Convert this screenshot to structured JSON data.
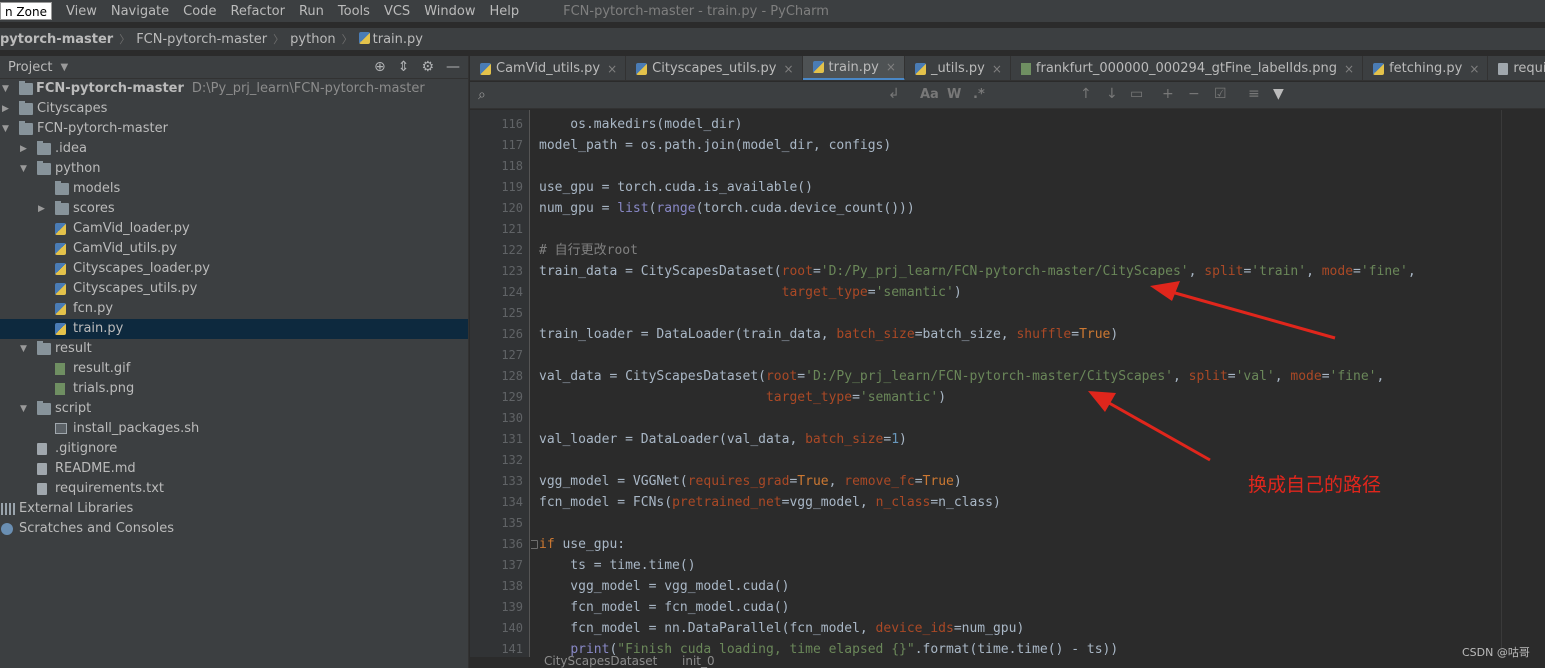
{
  "menubar": {
    "zone_label": "n Zone",
    "items": [
      "View",
      "Navigate",
      "Code",
      "Refactor",
      "Run",
      "Tools",
      "VCS",
      "Window",
      "Help"
    ],
    "window_title": "FCN-pytorch-master - train.py - PyCharm"
  },
  "breadcrumbs": [
    "pytorch-master",
    "FCN-pytorch-master",
    "python",
    "train.py"
  ],
  "project": {
    "header_label": "Project",
    "root_name": "FCN-pytorch-master",
    "root_path": "D:\\Py_prj_learn\\FCN-pytorch-master",
    "tree": [
      {
        "label": "Cityscapes",
        "kind": "folder",
        "depth": 0,
        "arrow": "right"
      },
      {
        "label": "FCN-pytorch-master",
        "kind": "folder",
        "depth": 0,
        "arrow": "down"
      },
      {
        "label": ".idea",
        "kind": "folder",
        "depth": 1,
        "arrow": "right"
      },
      {
        "label": "python",
        "kind": "folder",
        "depth": 1,
        "arrow": "down"
      },
      {
        "label": "models",
        "kind": "folder",
        "depth": 2,
        "arrow": ""
      },
      {
        "label": "scores",
        "kind": "folder",
        "depth": 2,
        "arrow": "right"
      },
      {
        "label": "CamVid_loader.py",
        "kind": "py",
        "depth": 2,
        "arrow": ""
      },
      {
        "label": "CamVid_utils.py",
        "kind": "py",
        "depth": 2,
        "arrow": ""
      },
      {
        "label": "Cityscapes_loader.py",
        "kind": "py",
        "depth": 2,
        "arrow": ""
      },
      {
        "label": "Cityscapes_utils.py",
        "kind": "py",
        "depth": 2,
        "arrow": ""
      },
      {
        "label": "fcn.py",
        "kind": "py",
        "depth": 2,
        "arrow": ""
      },
      {
        "label": "train.py",
        "kind": "py",
        "depth": 2,
        "arrow": "",
        "selected": true
      },
      {
        "label": "result",
        "kind": "folder",
        "depth": 1,
        "arrow": "down"
      },
      {
        "label": "result.gif",
        "kind": "img",
        "depth": 2,
        "arrow": ""
      },
      {
        "label": "trials.png",
        "kind": "img",
        "depth": 2,
        "arrow": ""
      },
      {
        "label": "script",
        "kind": "folder",
        "depth": 1,
        "arrow": "down"
      },
      {
        "label": "install_packages.sh",
        "kind": "sh",
        "depth": 2,
        "arrow": ""
      },
      {
        "label": ".gitignore",
        "kind": "file",
        "depth": 1,
        "arrow": ""
      },
      {
        "label": "README.md",
        "kind": "file",
        "depth": 1,
        "arrow": ""
      },
      {
        "label": "requirements.txt",
        "kind": "file",
        "depth": 1,
        "arrow": ""
      },
      {
        "label": "External Libraries",
        "kind": "lib",
        "depth": -1,
        "arrow": ""
      },
      {
        "label": "Scratches and Consoles",
        "kind": "scratch",
        "depth": -1,
        "arrow": ""
      }
    ]
  },
  "tabs": [
    {
      "label": "CamVid_utils.py",
      "active": false
    },
    {
      "label": "Cityscapes_utils.py",
      "active": false
    },
    {
      "label": "train.py",
      "active": true
    },
    {
      "label": "_utils.py",
      "active": false
    },
    {
      "label": "frankfurt_000000_000294_gtFine_labelIds.png",
      "active": false
    },
    {
      "label": "fetching.py",
      "active": false
    },
    {
      "label": "requirements.txt",
      "active": false
    }
  ],
  "code": {
    "lines": [
      {
        "n": "116",
        "html": "    os.makedirs(model_dir)"
      },
      {
        "n": "117",
        "html": "model_path = os.path.join(model_dir, configs)"
      },
      {
        "n": "118",
        "html": ""
      },
      {
        "n": "119",
        "html": "use_gpu = torch.cuda.is_available()"
      },
      {
        "n": "120",
        "html": "num_gpu = <span class=\"bi\">list</span>(<span class=\"bi\">range</span>(torch.cuda.device_count()))"
      },
      {
        "n": "121",
        "html": ""
      },
      {
        "n": "122",
        "html": "<span class=\"cm\"># 自行更改root</span>"
      },
      {
        "n": "123",
        "html": "train_data = CityScapesDataset(<span class=\"param\">root</span>=<span class=\"str\">'D:/Py_prj_learn/FCN-pytorch-master/CityScapes'</span>, <span class=\"param\">split</span>=<span class=\"str\">'train'</span>, <span class=\"param\">mode</span>=<span class=\"str\">'fine'</span>,"
      },
      {
        "n": "124",
        "html": "                               <span class=\"param\">target_type</span>=<span class=\"str\">'semantic'</span>)"
      },
      {
        "n": "125",
        "html": ""
      },
      {
        "n": "126",
        "html": "train_loader = DataLoader(train_data, <span class=\"param\">batch_size</span>=batch_size, <span class=\"param\">shuffle</span>=<span class=\"kw\">True</span>)"
      },
      {
        "n": "127",
        "html": ""
      },
      {
        "n": "128",
        "html": "val_data = CityScapesDataset(<span class=\"param\">root</span>=<span class=\"str\">'D:/Py_prj_learn/FCN-pytorch-master/CityScapes'</span>, <span class=\"param\">split</span>=<span class=\"str\">'val'</span>, <span class=\"param\">mode</span>=<span class=\"str\">'fine'</span>,"
      },
      {
        "n": "129",
        "html": "                             <span class=\"param\">target_type</span>=<span class=\"str\">'semantic'</span>)"
      },
      {
        "n": "130",
        "html": ""
      },
      {
        "n": "131",
        "html": "val_loader = DataLoader(val_data, <span class=\"param\">batch_size</span>=<span class=\"str\" style=\"color:#6897bb\">1</span>)"
      },
      {
        "n": "132",
        "html": ""
      },
      {
        "n": "133",
        "html": "vgg_model = VGGNet(<span class=\"param\">requires_grad</span>=<span class=\"kw\">True</span>, <span class=\"param\">remove_fc</span>=<span class=\"kw\">True</span>)"
      },
      {
        "n": "134",
        "html": "fcn_model = FCNs(<span class=\"param\">pretrained_net</span>=vgg_model, <span class=\"param\">n_class</span>=n_class)"
      },
      {
        "n": "135",
        "html": ""
      },
      {
        "n": "136",
        "html": "<span class=\"kw\">if</span> use_gpu:",
        "fold": true
      },
      {
        "n": "137",
        "html": "    ts = time.time()"
      },
      {
        "n": "138",
        "html": "    vgg_model = vgg_model.cuda()"
      },
      {
        "n": "139",
        "html": "    fcn_model = fcn_model.cuda()"
      },
      {
        "n": "140",
        "html": "    fcn_model = nn.DataParallel(fcn_model, <span class=\"param\">device_ids</span>=num_gpu)"
      },
      {
        "n": "141",
        "html": "    <span class=\"bi\">print</span>(<span class=\"str\">\"Finish cuda loading, time elapsed {}\"</span>.format(time.time() - ts))"
      }
    ]
  },
  "editor_breadcrumbs": [
    "CityScapesDataset",
    "init_0"
  ],
  "annotation": {
    "text": "换成自己的路径",
    "color": "#e0261c"
  },
  "watermark": "CSDN @咕哥"
}
